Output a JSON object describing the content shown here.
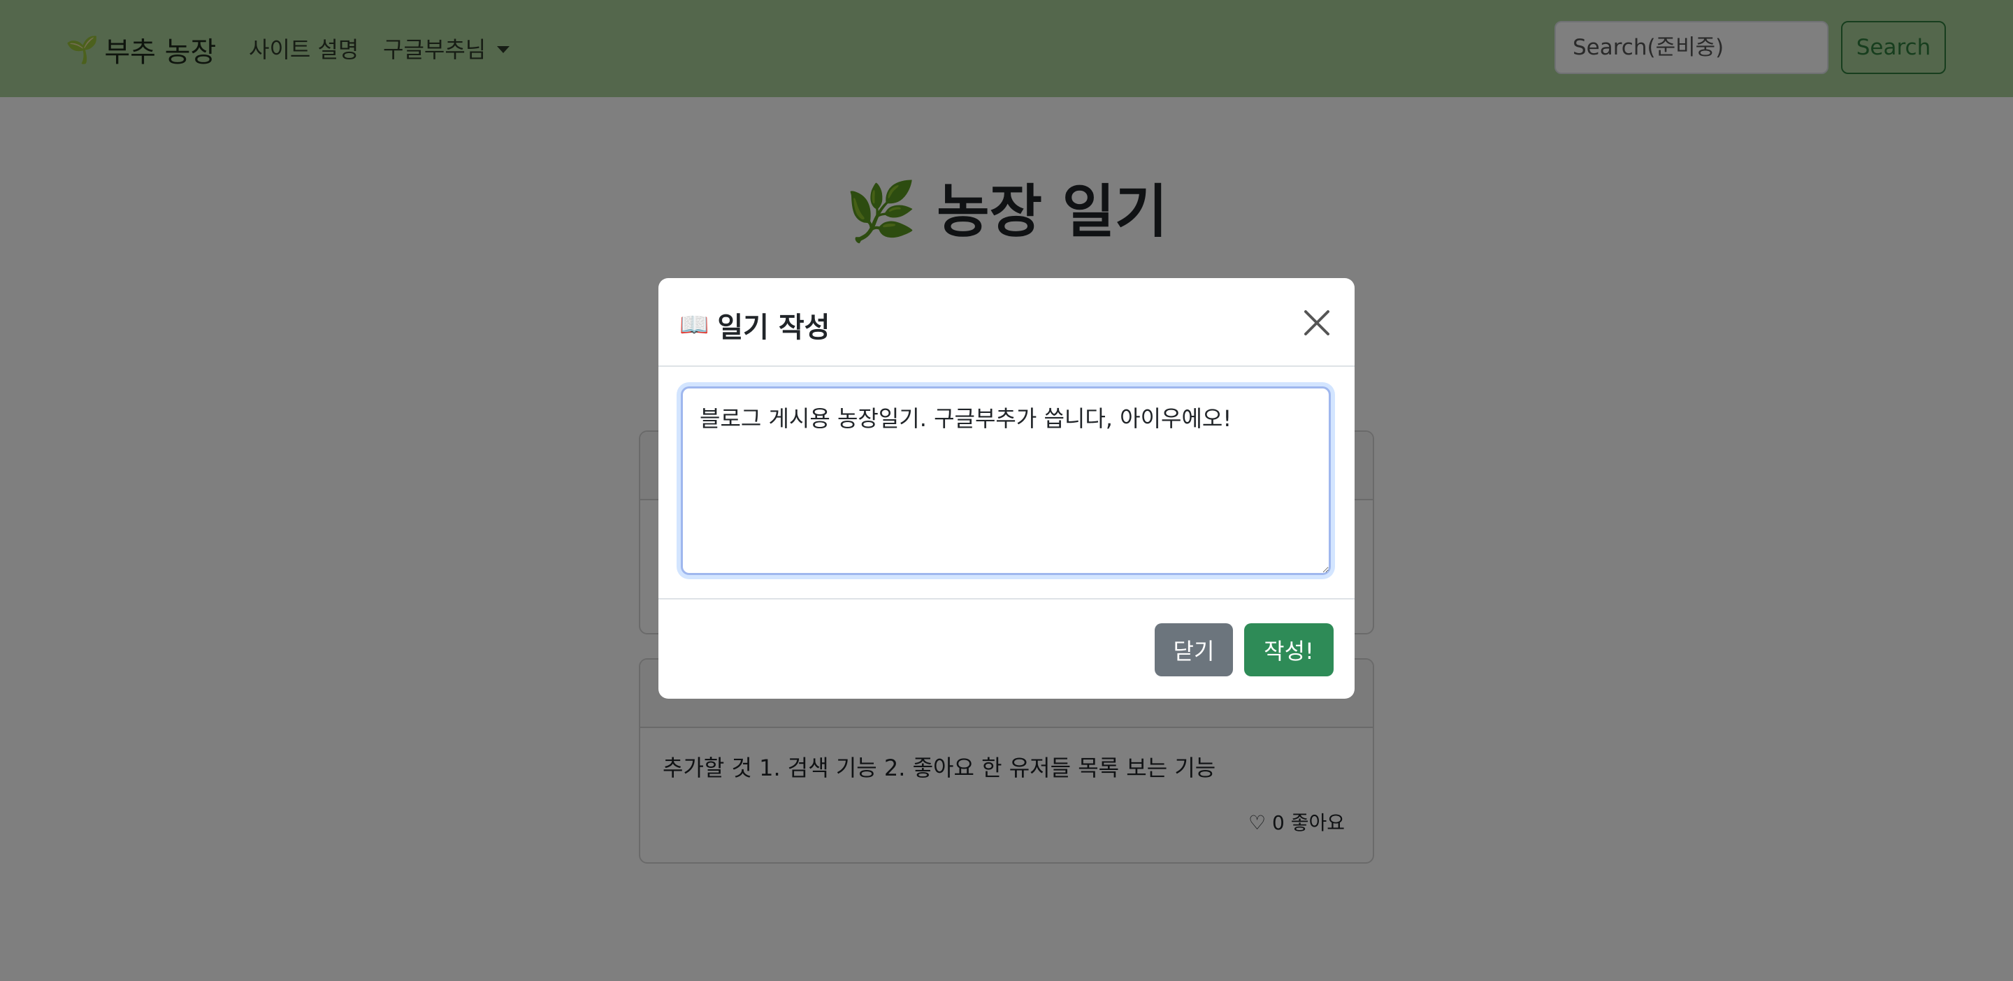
{
  "navbar": {
    "brand_icon": "🌱",
    "brand_text": "부추 농장",
    "about_link": "사이트 설명",
    "user_menu": "구글부추님",
    "search_placeholder": "Search(준비중)",
    "search_button": "Search",
    "bg_color": "#a9cf98"
  },
  "page": {
    "title_icon": "🌿",
    "title": "농장 일기"
  },
  "posts": [
    {
      "author": "",
      "date": "",
      "text": "",
      "like_count": "",
      "like_label": ""
    },
    {
      "author": "",
      "date": "",
      "text": "추가할 것 1. 검색 기능 2. 좋아요 한 유저들 목록 보는 기능",
      "like_icon": "♡",
      "like_count": "0",
      "like_label": "좋아요"
    }
  ],
  "modal": {
    "title_icon": "📖",
    "title": "일기 작성",
    "textarea_value": "블로그 게시용 농장일기. 구글부추가 씁니다, 아이우에오!",
    "close_button": "닫기",
    "submit_button": "작성!",
    "submit_color": "#2e8b57",
    "close_color": "#6c757d"
  },
  "icons": {
    "sprout": "sprout-icon",
    "herb": "herb-icon",
    "book": "book-icon",
    "close": "close-icon",
    "heart": "heart-outline-icon",
    "caret": "caret-down-icon"
  }
}
